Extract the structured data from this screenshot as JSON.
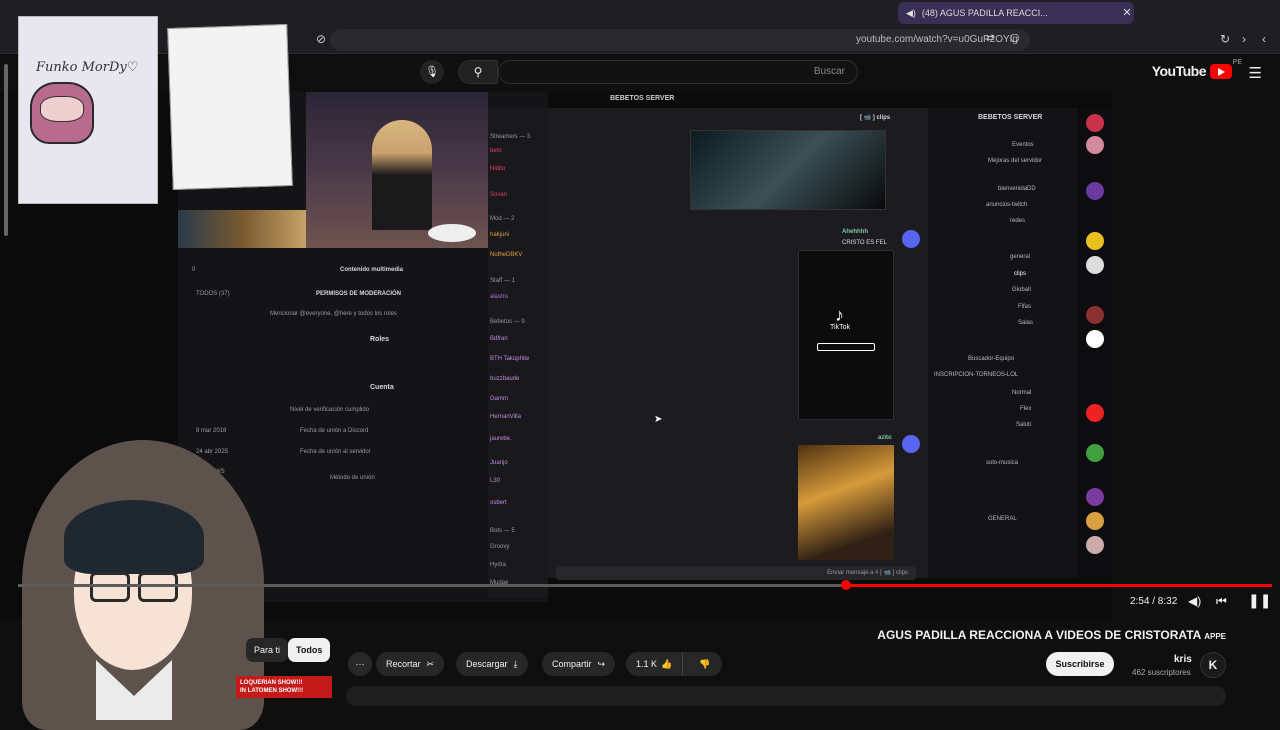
{
  "browser": {
    "tab_title": "(48) AGUS PADILLA REACCI...",
    "tab_icon": "sound-icon",
    "url": "youtube.com/watch?v=u0GuP2OYIg"
  },
  "youtube": {
    "logo_text": "YouTube",
    "region": "PE",
    "search_placeholder": "Buscar"
  },
  "discord": {
    "server_name": "BEBETOS SERVER",
    "channel_header": "[ 📹 ] clips",
    "channels": [
      "Eventos",
      "Mejoras del servidor",
      "bienvenidaDD",
      "anuncios-twitch",
      "redes",
      "general",
      "clips",
      "GlobalI",
      "Fifas",
      "Salas",
      "Buscador-Equipo",
      "INSCRIPCION-TORNEOS-LOL",
      "Normal",
      "Flex",
      "Saluti",
      "solo-musica",
      "GENERAL"
    ],
    "members": [
      "beto",
      "Nidito",
      "Sovan",
      "hakjuni",
      "NotheDBKV",
      "alastro",
      "Bdfran",
      "BTH Takophite",
      "buzzbaude",
      "Gamm",
      "HernanVilla",
      "jaurebe.",
      "Juanjo",
      "L30",
      "osbert",
      "Groovy",
      "Hydra",
      "Mudae"
    ],
    "member_groups": [
      "Streamers — 3",
      "Mod — 2",
      "Staff — 1",
      "Bebetos — 9",
      "Bots — 5"
    ],
    "message_author_1": "Ahehhhh",
    "message_text_1": "CRISTO ES FEL",
    "message_author_2": "azito",
    "tiktok_label": "TikTok",
    "chat_placeholder": "Enviar mensaje a # [ 📹 ] clips",
    "profile": {
      "embed": "Contenido multimedia",
      "permissions": "PERMISOS DE MODERACIÓN",
      "permissions_value": "TODOS (37)",
      "mention": "Mencionar @everyone, @here y todos los roles",
      "roles": "Roles",
      "account": "Cuenta",
      "verification": "Nivel de verificación cumplido",
      "discord_joined": "Fecha de unión a Discord",
      "discord_joined_value": "8 mar 2018",
      "server_joined": "Fecha de unión al servidor",
      "server_joined_value": "24 abr 2025",
      "join_method": "Método de unión",
      "join_method_value": "gwWWWS"
    }
  },
  "overlay": {
    "funko_text": "Funko MorDy♡"
  },
  "player": {
    "time": "2:54 / 8:32",
    "progress": 0.34
  },
  "video": {
    "title": "AGUS PADILLA REACCIONA A VIDEOS DE CRISTORATA",
    "title_badge": "APPE",
    "channel_name": "kris",
    "channel_initial": "K",
    "subscribers": "462 suscriptores",
    "subscribe_label": "Suscribirse",
    "likes": "1.1 K",
    "share_label": "Compartir",
    "download_label": "Descargar",
    "clip_label": "Recortar",
    "more_label": "···"
  },
  "chips": {
    "all": "Todos",
    "for_you": "Para ti"
  },
  "promo": {
    "line1": "LOQUERIAN SHOW!!!",
    "line2": "IN LATOMEN SHOW!!!"
  }
}
